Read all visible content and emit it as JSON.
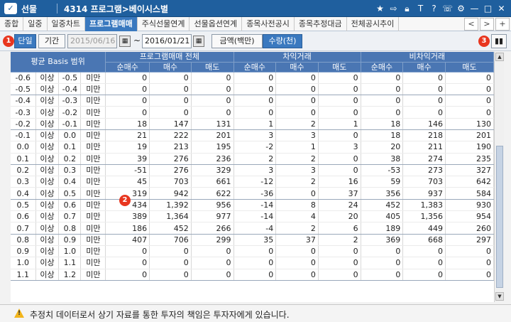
{
  "window": {
    "section": "선물",
    "title": "4314 프로그램>베이시스별",
    "icons": [
      "star-icon",
      "export-icon",
      "lock-icon",
      "text-icon",
      "help-icon",
      "phone-icon",
      "settings-icon",
      "minimize-icon",
      "maximize-icon",
      "close-icon"
    ]
  },
  "tabs": [
    "종합",
    "일중",
    "일중차트",
    "프로그램매매",
    "주식선물연계",
    "선물옵션연계",
    "종목사전공시",
    "종목추정대금",
    "전체공시추이"
  ],
  "tab_nav": {
    "prev": "<",
    "next": ">",
    "add": "+"
  },
  "toolbar": {
    "badge1": "1",
    "single": "단일",
    "period": "기간",
    "start_date": "2015/06/16",
    "tilde": "~",
    "end_date": "2016/01/21",
    "amount": "금액(백만)",
    "quantity": "수량(천)",
    "badge3": "3"
  },
  "badge2": "2",
  "table": {
    "header_basis": "평균 Basis 범위",
    "groups": [
      "프로그램매매 전체",
      "차익거래",
      "비차익거래"
    ],
    "sub": [
      "순매수",
      "매수",
      "매도"
    ],
    "rows": [
      [
        "-0.6",
        "이상",
        "-0.5",
        "미만",
        "0",
        "0",
        "0",
        "0",
        "0",
        "0",
        "0",
        "0",
        "0"
      ],
      [
        "-0.5",
        "이상",
        "-0.4",
        "미만",
        "0",
        "0",
        "0",
        "0",
        "0",
        "0",
        "0",
        "0",
        "0"
      ],
      [
        "-0.4",
        "이상",
        "-0.3",
        "미만",
        "0",
        "0",
        "0",
        "0",
        "0",
        "0",
        "0",
        "0",
        "0"
      ],
      [
        "-0.3",
        "이상",
        "-0.2",
        "미만",
        "0",
        "0",
        "0",
        "0",
        "0",
        "0",
        "0",
        "0",
        "0"
      ],
      [
        "-0.2",
        "이상",
        "-0.1",
        "미만",
        "18",
        "147",
        "131",
        "1",
        "2",
        "1",
        "18",
        "146",
        "130"
      ],
      [
        "-0.1",
        "이상",
        "0.0",
        "미만",
        "21",
        "222",
        "201",
        "3",
        "3",
        "0",
        "18",
        "218",
        "201"
      ],
      [
        "0.0",
        "이상",
        "0.1",
        "미만",
        "19",
        "213",
        "195",
        "-2",
        "1",
        "3",
        "20",
        "211",
        "190"
      ],
      [
        "0.1",
        "이상",
        "0.2",
        "미만",
        "39",
        "276",
        "236",
        "2",
        "2",
        "0",
        "38",
        "274",
        "235"
      ],
      [
        "0.2",
        "이상",
        "0.3",
        "미만",
        "-51",
        "276",
        "329",
        "3",
        "3",
        "0",
        "-53",
        "273",
        "327"
      ],
      [
        "0.3",
        "이상",
        "0.4",
        "미만",
        "45",
        "703",
        "661",
        "-12",
        "2",
        "16",
        "59",
        "703",
        "642"
      ],
      [
        "0.4",
        "이상",
        "0.5",
        "미만",
        "319",
        "942",
        "622",
        "-36",
        "0",
        "37",
        "356",
        "937",
        "584"
      ],
      [
        "0.5",
        "이상",
        "0.6",
        "미만",
        "434",
        "1,392",
        "956",
        "-14",
        "8",
        "24",
        "452",
        "1,383",
        "930"
      ],
      [
        "0.6",
        "이상",
        "0.7",
        "미만",
        "389",
        "1,364",
        "977",
        "-14",
        "4",
        "20",
        "405",
        "1,356",
        "954"
      ],
      [
        "0.7",
        "이상",
        "0.8",
        "미만",
        "186",
        "452",
        "266",
        "-4",
        "2",
        "6",
        "189",
        "449",
        "260"
      ],
      [
        "0.8",
        "이상",
        "0.9",
        "미만",
        "407",
        "706",
        "299",
        "35",
        "37",
        "2",
        "369",
        "668",
        "297"
      ],
      [
        "0.9",
        "이상",
        "1.0",
        "미만",
        "0",
        "0",
        "0",
        "0",
        "0",
        "0",
        "0",
        "0",
        "0"
      ],
      [
        "1.0",
        "이상",
        "1.1",
        "미만",
        "0",
        "0",
        "0",
        "0",
        "0",
        "0",
        "0",
        "0",
        "0"
      ],
      [
        "1.1",
        "이상",
        "1.2",
        "미만",
        "0",
        "0",
        "0",
        "0",
        "0",
        "0",
        "0",
        "0",
        "0"
      ]
    ]
  },
  "scrollbar": {
    "up": "▲",
    "down": "▼"
  },
  "footer": {
    "message": "추정치 데이터로서 상기 자료를 통한 투자의 책임은 투자자에게 있습니다."
  },
  "colors": {
    "title_bar": "#1f5f9e",
    "header": "#4a76b3",
    "active_tab": "#3a79bf",
    "badge": "#e8361f"
  }
}
